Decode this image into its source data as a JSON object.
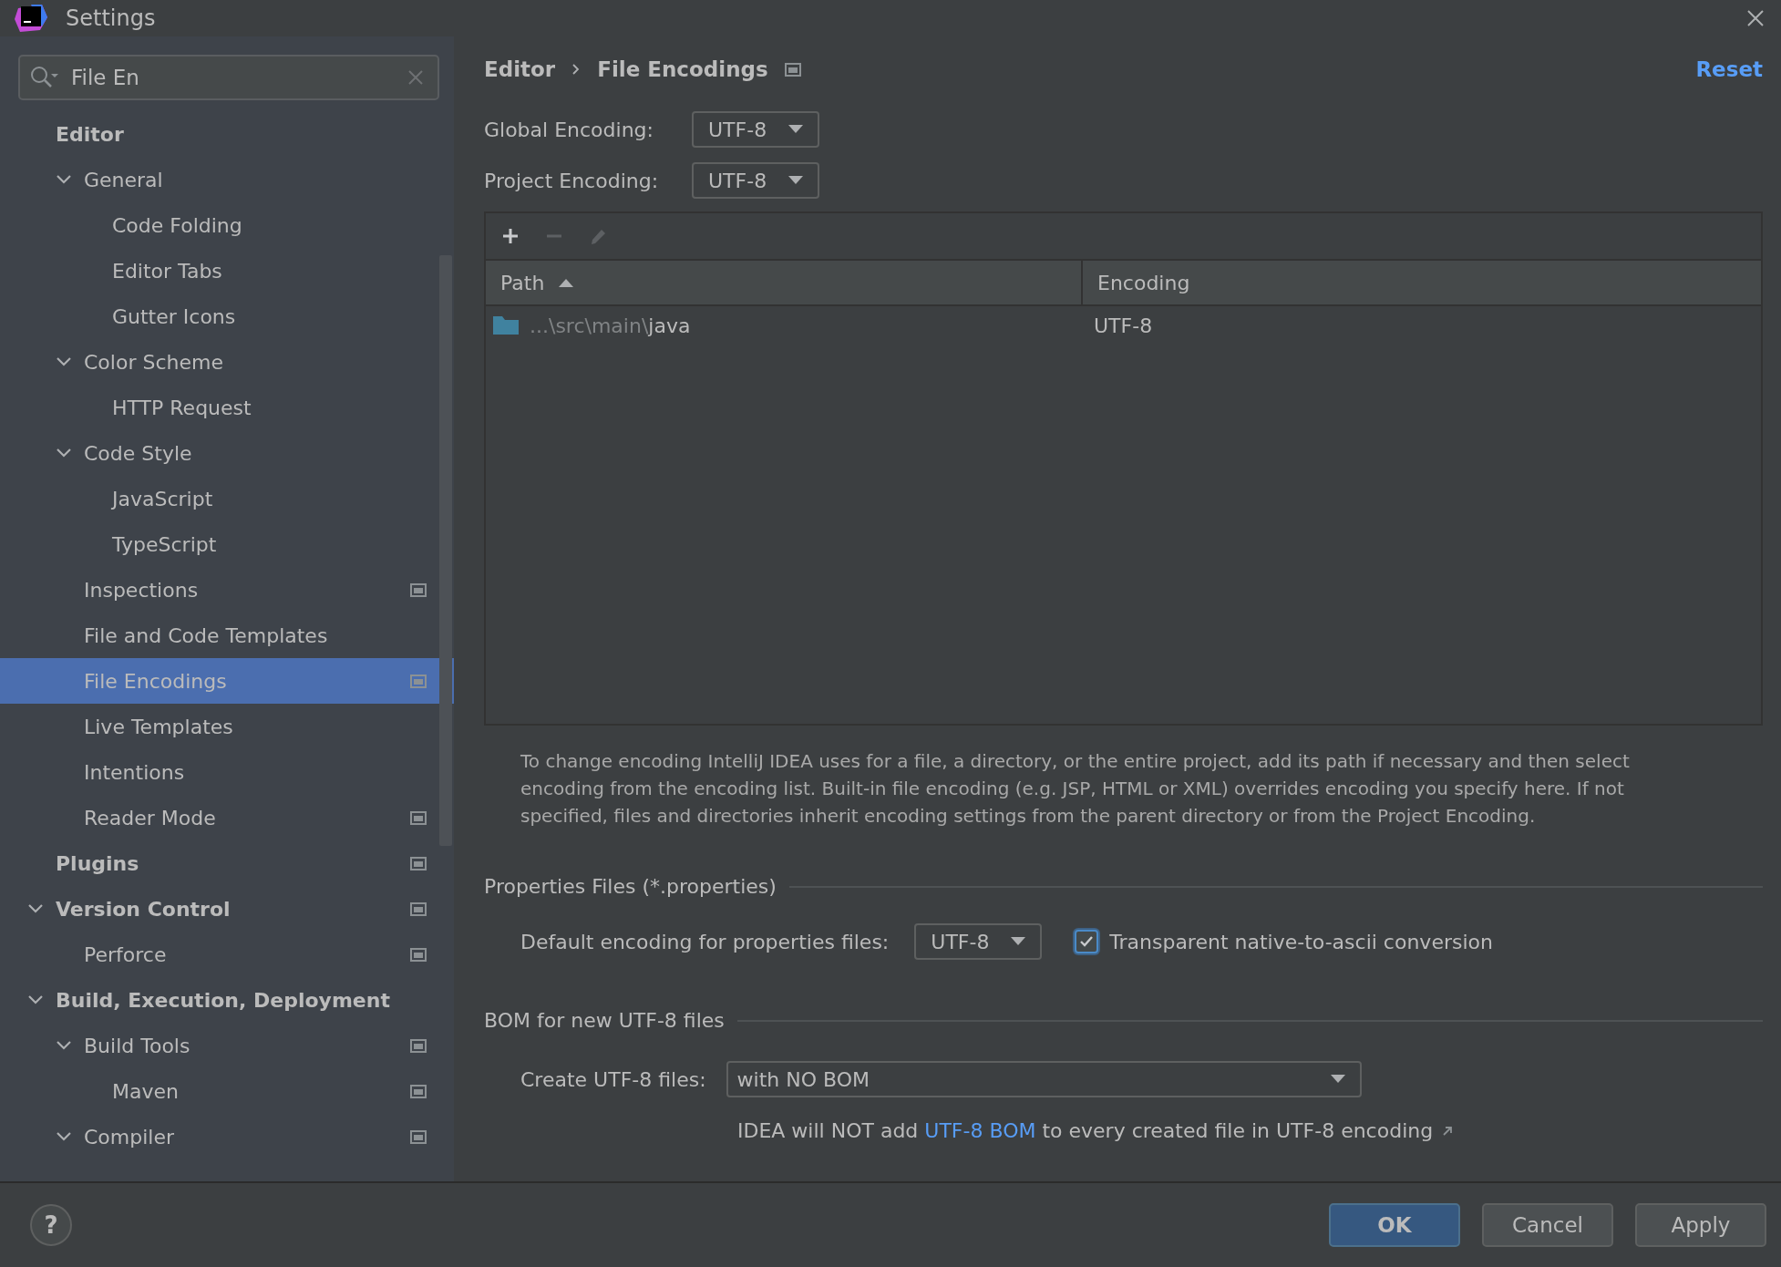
{
  "window": {
    "title": "Settings"
  },
  "search": {
    "value": "File En"
  },
  "tree": [
    {
      "label": "Editor",
      "selected": false,
      "badge": false,
      "children": [
        {
          "label": "General",
          "expanded": true,
          "selected": false,
          "badge": false,
          "children": [
            {
              "label": "Code Folding",
              "selected": false,
              "badge": false
            },
            {
              "label": "Editor Tabs",
              "selected": false,
              "badge": false
            },
            {
              "label": "Gutter Icons",
              "selected": false,
              "badge": false
            }
          ]
        },
        {
          "label": "Color Scheme",
          "expanded": true,
          "selected": false,
          "badge": false,
          "children": [
            {
              "label": "HTTP Request",
              "selected": false,
              "badge": false
            }
          ]
        },
        {
          "label": "Code Style",
          "expanded": true,
          "selected": false,
          "badge": false,
          "children": [
            {
              "label": "JavaScript",
              "selected": false,
              "badge": false
            },
            {
              "label": "TypeScript",
              "selected": false,
              "badge": false
            }
          ]
        },
        {
          "label": "Inspections",
          "selected": false,
          "badge": true
        },
        {
          "label": "File and Code Templates",
          "selected": false,
          "badge": false
        },
        {
          "label": "File Encodings",
          "selected": true,
          "badge": true
        },
        {
          "label": "Live Templates",
          "selected": false,
          "badge": false
        },
        {
          "label": "Intentions",
          "selected": false,
          "badge": false
        },
        {
          "label": "Reader Mode",
          "selected": false,
          "badge": true
        }
      ]
    },
    {
      "label": "Plugins",
      "selected": false,
      "badge": true
    },
    {
      "label": "Version Control",
      "expanded": true,
      "selected": false,
      "badge": true,
      "children": [
        {
          "label": "Perforce",
          "selected": false,
          "badge": true
        }
      ]
    },
    {
      "label": "Build, Execution, Deployment",
      "expanded": true,
      "selected": false,
      "badge": false,
      "children": [
        {
          "label": "Build Tools",
          "expanded": true,
          "selected": false,
          "badge": true,
          "children": [
            {
              "label": "Maven",
              "selected": false,
              "badge": true
            }
          ]
        },
        {
          "label": "Compiler",
          "expanded": true,
          "selected": false,
          "badge": true
        }
      ]
    }
  ],
  "breadcrumb": [
    "Editor",
    "File Encodings"
  ],
  "reset": "Reset",
  "encodings": [
    {
      "label": "Global Encoding:",
      "value": "UTF-8"
    },
    {
      "label": "Project Encoding:",
      "value": "UTF-8"
    }
  ],
  "toolbar": [
    {
      "kind": "add",
      "disabled": false
    },
    {
      "kind": "remove",
      "disabled": true
    },
    {
      "kind": "edit",
      "disabled": true
    }
  ],
  "table": {
    "columns": [
      {
        "label": "Path",
        "sorted": true
      },
      {
        "label": "Encoding",
        "sorted": false
      }
    ],
    "rows": [
      {
        "path_prefix": "...\\src\\main\\",
        "path_name": "java",
        "encoding": "UTF-8"
      }
    ]
  },
  "description": "To change encoding IntelliJ IDEA uses for a file, a directory, or the entire project, add its path if necessary and then select encoding from the encoding list. Built-in file encoding (e.g. JSP, HTML or XML) overrides encoding you specify here. If not specified, files and directories inherit encoding settings from the parent directory or from the Project Encoding.",
  "properties": {
    "title": "Properties Files (*.properties)",
    "label": "Default encoding for properties files:",
    "value": "UTF-8",
    "checkbox": {
      "label": "Transparent native-to-ascii conversion",
      "checked": true
    }
  },
  "bom": {
    "title": "BOM for new UTF-8 files",
    "label": "Create UTF-8 files:",
    "value": "with NO BOM",
    "note_before": "IDEA will NOT add ",
    "note_link": "UTF-8 BOM",
    "note_after": " to every created file in UTF-8 encoding"
  },
  "help": "?",
  "buttons": [
    {
      "label": "OK",
      "kind": "primary"
    },
    {
      "label": "Cancel",
      "kind": "normal"
    },
    {
      "label": "Apply",
      "kind": "normal"
    }
  ]
}
